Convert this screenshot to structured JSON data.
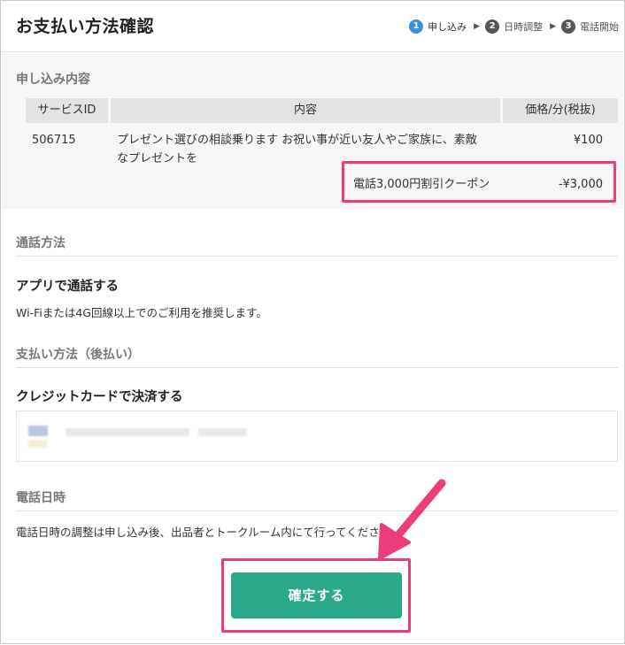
{
  "header": {
    "title": "お支払い方法確認",
    "steps": [
      {
        "num": "1",
        "label": "申し込み",
        "active": true
      },
      {
        "num": "2",
        "label": "日時調整",
        "active": false
      },
      {
        "num": "3",
        "label": "電話開始",
        "active": false
      }
    ]
  },
  "order": {
    "section_title": "申し込み内容",
    "columns": {
      "service_id": "サービスID",
      "content": "内容",
      "price": "価格/分(税抜)"
    },
    "row": {
      "service_id": "506715",
      "content_line1": "プレゼント選びの相談乗ります お祝い事が近い友人やご家族に、素敵",
      "content_line2": "なプレゼントを",
      "price": "¥100"
    },
    "coupon": {
      "label": "電話3,000円割引クーポン",
      "amount": "-¥3,000"
    }
  },
  "call_method": {
    "section_title": "通話方法",
    "option": "アプリで通話する",
    "note": "Wi-Fiまたは4G回線以上でのご利用を推奨します。"
  },
  "payment": {
    "section_title": "支払い方法（後払い）",
    "option": "クレジットカードで決済する"
  },
  "call_datetime": {
    "section_title": "電話日時",
    "note": "電話日時の調整は申し込み後、出品者とトークルーム内にて行ってください。"
  },
  "confirm_button": {
    "label": "確定する"
  },
  "colors": {
    "accent_green": "#2aa98a",
    "highlight_pink": "#ec3c7c",
    "step_active": "#3b8fd6"
  }
}
